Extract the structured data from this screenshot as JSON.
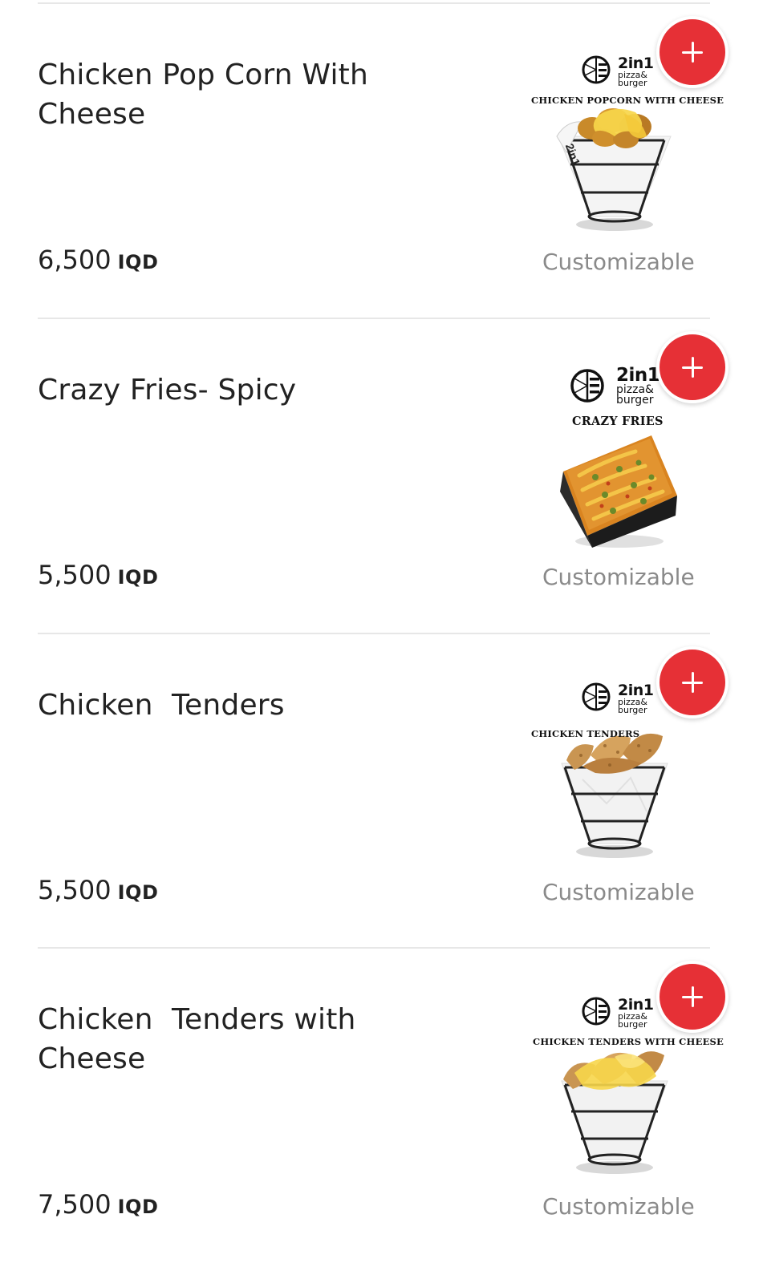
{
  "menu": {
    "items": [
      {
        "name": "Chicken Pop Corn With Cheese",
        "price": "6,500",
        "currency": "IQD",
        "tag": "Customizable",
        "image": {
          "brand": "2in1",
          "brand_sub1": "pizza&",
          "brand_sub2": "burger",
          "title": "CHICKEN POPCORN WITH CHEESE",
          "food": "popcorn-chicken-cheese-basket"
        }
      },
      {
        "name": "Crazy Fries- Spicy",
        "price": "5,500",
        "currency": "IQD",
        "tag": "Customizable",
        "image": {
          "brand": "2in1",
          "brand_sub1": "pizza&",
          "brand_sub2": "burger",
          "title": "CRAZY FRIES",
          "food": "loaded-fries-tray"
        }
      },
      {
        "name": "Chicken  Tenders",
        "price": "5,500",
        "currency": "IQD",
        "tag": "Customizable",
        "image": {
          "brand": "2in1",
          "brand_sub1": "pizza&",
          "brand_sub2": "burger",
          "title": "CHICKEN TENDERS",
          "food": "chicken-tenders-basket"
        }
      },
      {
        "name": "Chicken  Tenders with Cheese",
        "price": "7,500",
        "currency": "IQD",
        "tag": "Customizable",
        "image": {
          "brand": "2in1",
          "brand_sub1": "pizza&",
          "brand_sub2": "burger",
          "title": "CHICKEN TENDERS WITH CHEESE",
          "food": "chicken-tenders-cheese-basket"
        }
      }
    ],
    "add_icon": "plus-icon",
    "colors": {
      "add_button": "#e63036",
      "text_primary": "#222222",
      "text_secondary": "#8a8a8a",
      "divider": "#e7e7e7"
    }
  }
}
